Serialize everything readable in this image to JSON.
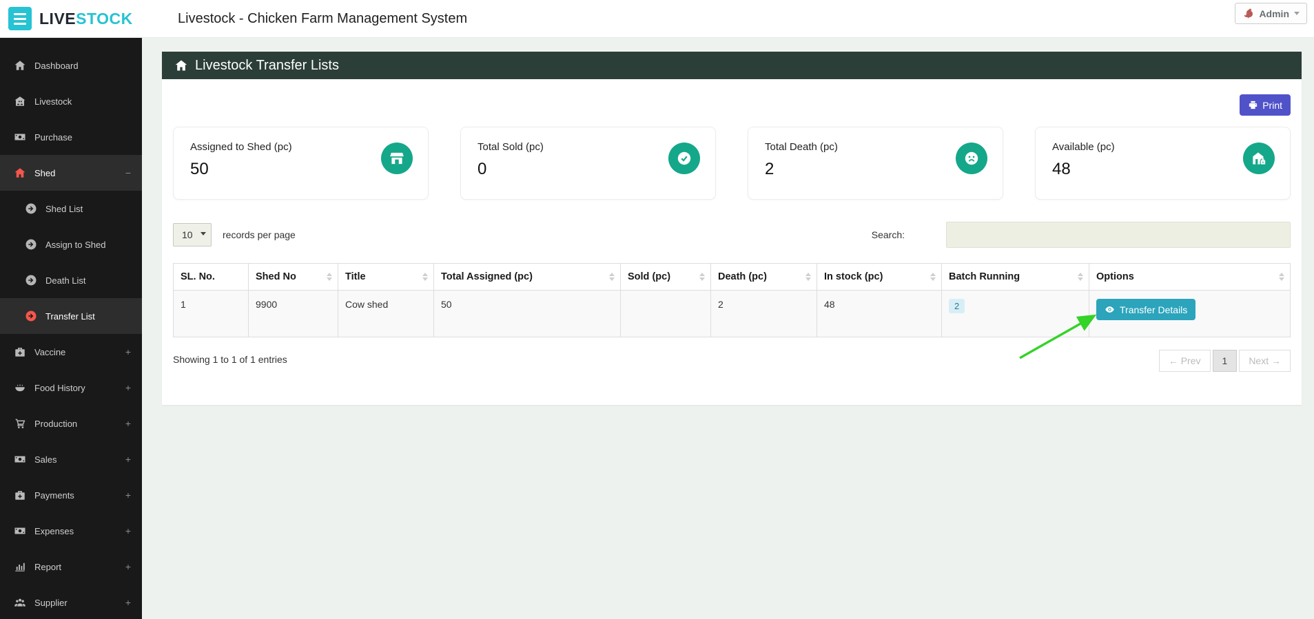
{
  "brand": {
    "logo_live": "LIVE",
    "logo_stock": "STOCK"
  },
  "topbar": {
    "title": "Livestock - Chicken Farm Management System",
    "user": {
      "name": "Admin"
    }
  },
  "sidebar": {
    "items": [
      {
        "label": "Dashboard"
      },
      {
        "label": "Livestock"
      },
      {
        "label": "Purchase"
      },
      {
        "label": "Shed",
        "toggle": "−"
      },
      {
        "label": "Shed List"
      },
      {
        "label": "Assign to Shed"
      },
      {
        "label": "Death List"
      },
      {
        "label": "Transfer List"
      },
      {
        "label": "Vaccine",
        "toggle": "+"
      },
      {
        "label": "Food History",
        "toggle": "+"
      },
      {
        "label": "Production",
        "toggle": "+"
      },
      {
        "label": "Sales",
        "toggle": "+"
      },
      {
        "label": "Payments",
        "toggle": "+"
      },
      {
        "label": "Expenses",
        "toggle": "+"
      },
      {
        "label": "Report",
        "toggle": "+"
      },
      {
        "label": "Supplier",
        "toggle": "+"
      }
    ]
  },
  "panel": {
    "title": "Livestock Transfer Lists",
    "print_label": "Print"
  },
  "stats": {
    "cards": [
      {
        "label": "Assigned to Shed (pc)",
        "value": "50",
        "icon": "storefront-icon"
      },
      {
        "label": "Total Sold (pc)",
        "value": "0",
        "icon": "check-circle-icon"
      },
      {
        "label": "Total Death (pc)",
        "value": "2",
        "icon": "frown-icon"
      },
      {
        "label": "Available (pc)",
        "value": "48",
        "icon": "store-lock-icon"
      }
    ]
  },
  "controls": {
    "page_size": "10",
    "records_text": "records per page",
    "search_label": "Search:",
    "search_value": ""
  },
  "table": {
    "columns": [
      "SL. No.",
      "Shed No",
      "Title",
      "Total Assigned (pc)",
      "Sold (pc)",
      "Death (pc)",
      "In stock (pc)",
      "Batch Running",
      "Options"
    ],
    "row": {
      "sl": "1",
      "shed_no": "9900",
      "title": "Cow shed",
      "total_assigned": "50",
      "sold": "",
      "death": "2",
      "in_stock": "48",
      "batch_running": "2",
      "option_label": "Transfer Details"
    }
  },
  "footer": {
    "summary": "Showing 1 to 1 of 1 entries",
    "prev_label": "← Prev",
    "page_label": "1",
    "next_label": "Next →"
  },
  "colors": {
    "brand_cyan": "#25c3d3",
    "sidebar_bg": "#191919",
    "accent_red": "#f7564c",
    "panel_header_bg": "#2b3e38",
    "print_btn": "#5052c9",
    "stat_icon_teal": "#15a78a",
    "transfer_btn": "#2ba4bc",
    "badge_bg": "#d8eef7",
    "annotation_green": "#34d327",
    "page_bg": "#eef2ee"
  }
}
